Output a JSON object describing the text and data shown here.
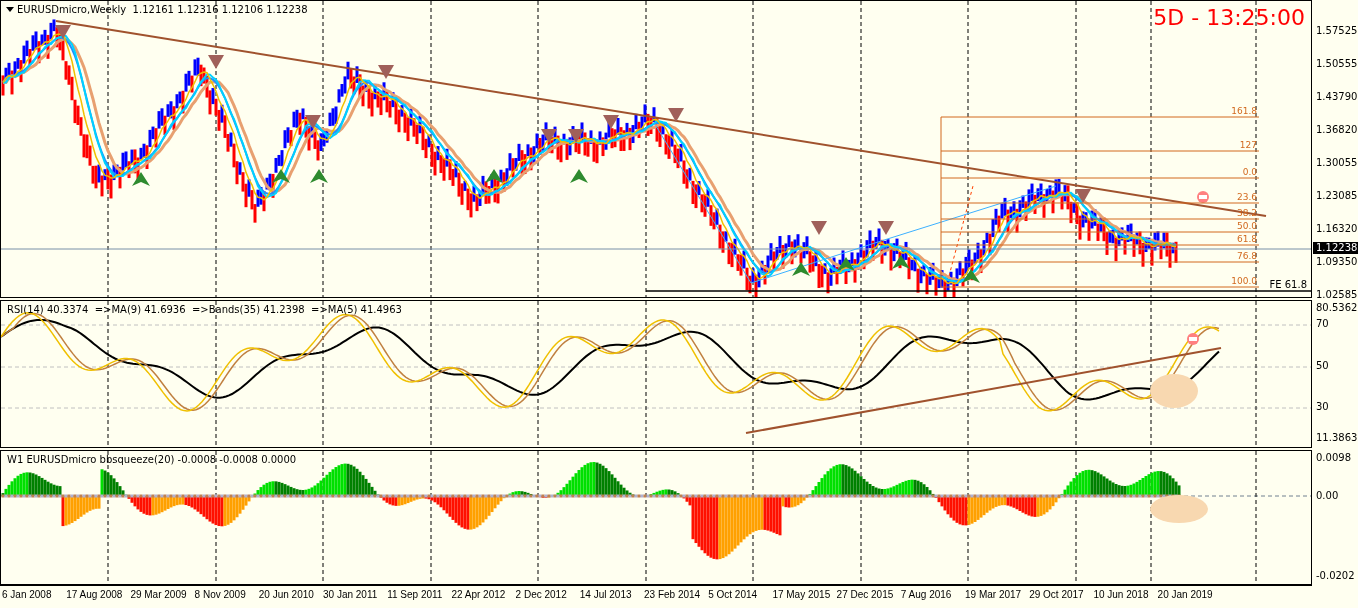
{
  "main_chart": {
    "symbol_header": "EURUSDmicro,Weekly",
    "ohlc": "1.12161 1.12316 1.12106 1.12238",
    "countdown": "5D - 13:25:00",
    "price_axis": [
      "1.57525",
      "1.50555",
      "1.43790",
      "1.36820",
      "1.30055",
      "1.23085",
      "1.16320",
      "1.09350",
      "1.02585"
    ],
    "current_price": "1.12238",
    "fib_levels": [
      "161.8",
      "127",
      "0.0",
      "23.6",
      "38.2",
      "50.0",
      "61.8",
      "76.8",
      "100.0"
    ],
    "fe_label": "FE 61.8"
  },
  "rsi_panel": {
    "header": "RSI(14) 40.3374  =>MA(9) 41.6936  =>Bands(35) 41.2398  =>MA(5) 41.4963",
    "axis": [
      "80.5362",
      "70",
      "50",
      "30",
      "11.3863"
    ]
  },
  "squeeze_panel": {
    "header": "W1 EURUSDmicro bbsqueeze(20) -0.0008 -0.0008 0.0000",
    "axis": [
      "0.0098",
      "0.00",
      "-0.0202"
    ]
  },
  "time_axis": [
    "6 Jan 2008",
    "17 Aug 2008",
    "29 Mar 2009",
    "8 Nov 2009",
    "20 Jun 2010",
    "30 Jan 2011",
    "11 Sep 2011",
    "22 Apr 2012",
    "2 Dec 2012",
    "14 Jul 2013",
    "23 Feb 2014",
    "5 Oct 2014",
    "17 May 2015",
    "27 Dec 2015",
    "7 Aug 2016",
    "19 Mar 2017",
    "29 Oct 2017",
    "10 Jun 2018",
    "20 Jan 2019"
  ]
}
